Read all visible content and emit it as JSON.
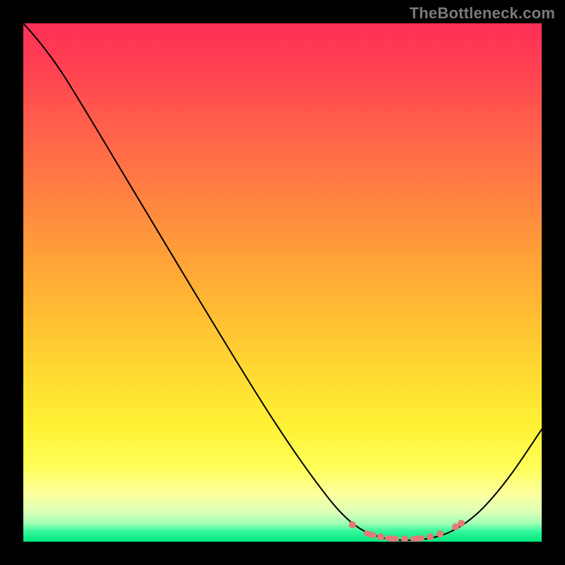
{
  "watermark": "TheBottleneck.com",
  "colors": {
    "page_bg": "#000000",
    "curve": "#000000",
    "dots": "#e47a78"
  },
  "chart_data": {
    "type": "line",
    "title": "",
    "xlabel": "",
    "ylabel": "",
    "xlim": [
      0,
      100
    ],
    "ylim": [
      0,
      100
    ],
    "series": [
      {
        "name": "bottleneck-curve",
        "x": [
          0,
          5,
          10,
          15,
          20,
          25,
          30,
          35,
          40,
          45,
          50,
          55,
          60,
          63,
          66,
          69,
          72,
          75,
          78,
          81,
          84,
          88,
          92,
          96,
          100
        ],
        "y": [
          100,
          96,
          91,
          85.5,
          79.5,
          73,
          66.5,
          59.5,
          52.5,
          45,
          37.5,
          29.5,
          21.5,
          16,
          11,
          6.5,
          3.5,
          1.5,
          0.5,
          0.5,
          1.5,
          5,
          11,
          19,
          29
        ]
      }
    ],
    "annotations": {
      "minimum_region_x": [
        70,
        84
      ],
      "minimum_region_y": [
        0.5,
        2.5
      ]
    }
  }
}
